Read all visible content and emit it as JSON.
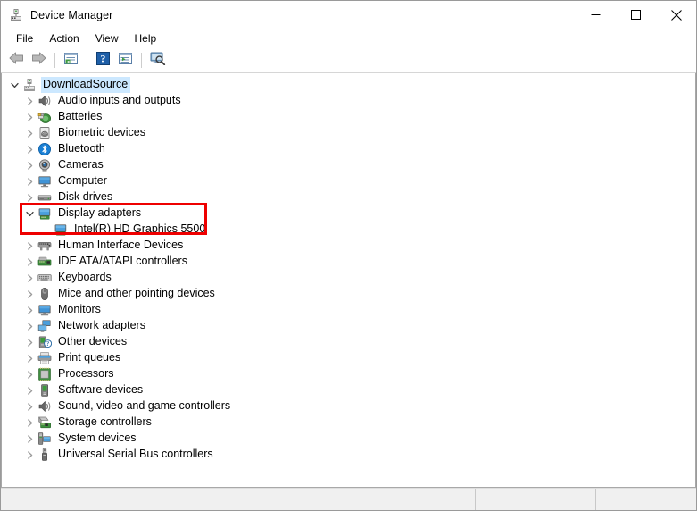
{
  "window": {
    "title": "Device Manager",
    "app_icon": "device-manager-icon",
    "controls": {
      "minimize": "minimize",
      "maximize": "maximize",
      "close": "close"
    }
  },
  "menubar": {
    "items": [
      {
        "label": "File"
      },
      {
        "label": "Action"
      },
      {
        "label": "View"
      },
      {
        "label": "Help"
      }
    ]
  },
  "toolbar": {
    "buttons": [
      {
        "name": "back-button",
        "icon": "back-arrow-icon",
        "title": "Back"
      },
      {
        "name": "forward-button",
        "icon": "forward-arrow-icon",
        "title": "Forward"
      },
      {
        "name": "properties-button",
        "icon": "properties-icon",
        "title": "Properties"
      },
      {
        "name": "help-button",
        "icon": "help-question-icon",
        "title": "Help"
      },
      {
        "name": "show-hide-console-tree-button",
        "icon": "console-tree-icon",
        "title": "Show/Hide Console Tree"
      },
      {
        "name": "scan-hardware-changes-button",
        "icon": "scan-hardware-icon",
        "title": "Scan for hardware changes"
      }
    ]
  },
  "tree": {
    "root": {
      "label": "DownloadSource",
      "icon": "computer-node-icon",
      "expanded": true,
      "selected": true
    },
    "nodes": [
      {
        "label": "Audio inputs and outputs",
        "icon": "speaker-icon",
        "expanded": false,
        "level": 1
      },
      {
        "label": "Batteries",
        "icon": "battery-icon",
        "expanded": false,
        "level": 1
      },
      {
        "label": "Biometric devices",
        "icon": "fingerprint-icon",
        "expanded": false,
        "level": 1
      },
      {
        "label": "Bluetooth",
        "icon": "bluetooth-icon",
        "expanded": false,
        "level": 1
      },
      {
        "label": "Cameras",
        "icon": "camera-icon",
        "expanded": false,
        "level": 1
      },
      {
        "label": "Computer",
        "icon": "monitor-icon",
        "expanded": false,
        "level": 1
      },
      {
        "label": "Disk drives",
        "icon": "disk-drive-icon",
        "expanded": false,
        "level": 1
      },
      {
        "label": "Display adapters",
        "icon": "display-adapter-icon",
        "expanded": true,
        "level": 1,
        "highlighted": true
      },
      {
        "label": "Intel(R) HD Graphics 5500",
        "icon": "display-adapter-icon",
        "expanded": null,
        "level": 2,
        "highlighted": true
      },
      {
        "label": "Human Interface Devices",
        "icon": "hid-icon",
        "expanded": false,
        "level": 1
      },
      {
        "label": "IDE ATA/ATAPI controllers",
        "icon": "ide-controller-icon",
        "expanded": false,
        "level": 1
      },
      {
        "label": "Keyboards",
        "icon": "keyboard-icon",
        "expanded": false,
        "level": 1
      },
      {
        "label": "Mice and other pointing devices",
        "icon": "mouse-icon",
        "expanded": false,
        "level": 1
      },
      {
        "label": "Monitors",
        "icon": "monitor-icon",
        "expanded": false,
        "level": 1
      },
      {
        "label": "Network adapters",
        "icon": "network-adapter-icon",
        "expanded": false,
        "level": 1
      },
      {
        "label": "Other devices",
        "icon": "other-device-icon",
        "expanded": false,
        "level": 1
      },
      {
        "label": "Print queues",
        "icon": "printer-icon",
        "expanded": false,
        "level": 1
      },
      {
        "label": "Processors",
        "icon": "processor-icon",
        "expanded": false,
        "level": 1
      },
      {
        "label": "Software devices",
        "icon": "software-device-icon",
        "expanded": false,
        "level": 1
      },
      {
        "label": "Sound, video and game controllers",
        "icon": "speaker-icon",
        "expanded": false,
        "level": 1
      },
      {
        "label": "Storage controllers",
        "icon": "storage-controller-icon",
        "expanded": false,
        "level": 1
      },
      {
        "label": "System devices",
        "icon": "system-device-icon",
        "expanded": false,
        "level": 1
      },
      {
        "label": "Universal Serial Bus controllers",
        "icon": "usb-icon",
        "expanded": false,
        "level": 1
      }
    ]
  },
  "annotation": {
    "color": "#ee0000",
    "target": "Display adapters"
  },
  "statusbar": {
    "main": "",
    "pane2": "",
    "pane3": ""
  }
}
